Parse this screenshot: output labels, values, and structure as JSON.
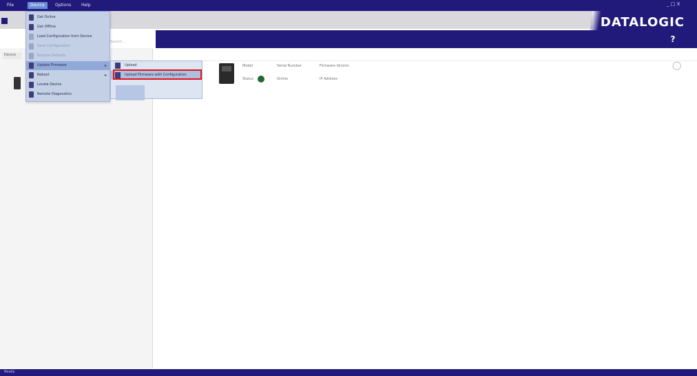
{
  "app": {
    "brand": "DATALOGIC"
  },
  "menubar": {
    "items": [
      {
        "label": "File"
      },
      {
        "label": "Device"
      },
      {
        "label": "Options"
      },
      {
        "label": "Help"
      }
    ],
    "window_controls": "_ □ X"
  },
  "dropdown": {
    "items": [
      {
        "label": "Get Online",
        "icon": "device-icon",
        "disabled": false
      },
      {
        "label": "Get Offline",
        "icon": "device-icon",
        "disabled": false
      },
      {
        "label": "Load Configuration from Device",
        "icon": "download-icon",
        "disabled": false
      },
      {
        "label": "Save Configuration",
        "icon": "save-icon",
        "disabled": true
      },
      {
        "label": "Restore Defaults",
        "icon": "restore-icon",
        "disabled": true
      },
      {
        "label": "Update Firmware",
        "icon": "update-icon",
        "disabled": false,
        "has_submenu": true
      },
      {
        "label": "Reboot",
        "icon": "reboot-icon",
        "disabled": false,
        "has_submenu": true
      },
      {
        "label": "Locate Device",
        "icon": "locate-icon",
        "disabled": false
      },
      {
        "label": "Remote Diagnostics",
        "icon": "diagnostics-icon",
        "disabled": false
      }
    ]
  },
  "submenu": {
    "items": [
      {
        "label": "Upload",
        "icon": "upload-icon"
      },
      {
        "label": "Upload Firmware with Configuration",
        "icon": "firmware-icon",
        "highlighted": true
      }
    ]
  },
  "left_panel": {
    "tab_label": "Device",
    "search_hint": "Search..."
  },
  "device_card": {
    "model_label": "Model",
    "model_value": "Serial Number",
    "serial_value": "Firmware Version",
    "status_label": "Status",
    "status_value": "Online",
    "ip_value": "IP Address"
  },
  "statusbar": {
    "text": "Ready"
  },
  "colors": {
    "brand": "#221a7a",
    "highlight": "#e0141c",
    "status_ok": "#1e6b2f"
  }
}
